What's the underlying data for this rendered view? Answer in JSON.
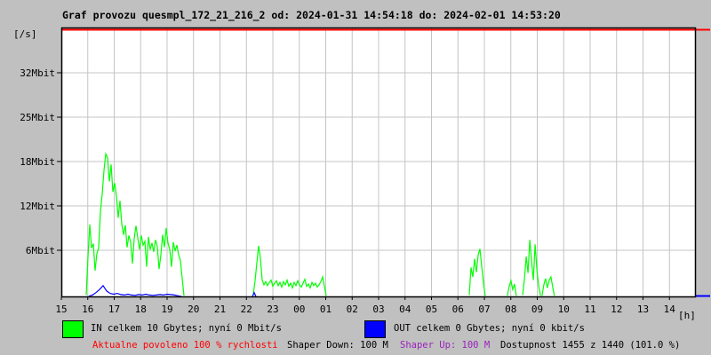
{
  "title": "Graf provozu quesmpl_172_21_216_2 od: 2024-01-31 14:54:18 do: 2024-02-01 14:53:20",
  "colors": {
    "background": "#c0c0c0",
    "plot_background": "#ffffff",
    "grid": "#c4c4c4",
    "border": "#000000",
    "in_series": "#00ff00",
    "out_series": "#0000ff",
    "down_limit_line": "#ff0000",
    "up_limit_line": "#0000ff",
    "allowed_text": "#ff0000",
    "shaper_up_text": "#9922bb"
  },
  "axis": {
    "y_unit": "[/s]",
    "x_unit": "[h]"
  },
  "legend": {
    "in": {
      "label": "IN celkem 10 Gbytes; nyní 0 Mbit/s"
    },
    "out": {
      "label": "OUT celkem 0 Gbytes; nyní 0 kbit/s"
    }
  },
  "footer": {
    "allowed": "Aktualne povoleno 100 % rychlosti",
    "shaper_down": "Shaper Down: 100 M",
    "shaper_up": "Shaper Up: 100 M",
    "availability": "Dostupnost 1455 z 1440 (101.0 %)"
  },
  "chart_data": {
    "type": "line",
    "title": "Graf provozu quesmpl_172_21_216_2 od: 2024-01-31 14:54:18 do: 2024-02-01 14:53:20",
    "xlabel": "[h]",
    "ylabel": "[/s]",
    "x_hour_labels": [
      "15",
      "16",
      "17",
      "18",
      "19",
      "20",
      "21",
      "22",
      "23",
      "00",
      "01",
      "02",
      "03",
      "04",
      "05",
      "06",
      "07",
      "08",
      "09",
      "10",
      "11",
      "12",
      "13",
      "14"
    ],
    "x_range_hours": [
      0,
      24
    ],
    "y_ticks": [
      {
        "label": "6Mbit",
        "value": 6
      },
      {
        "label": "12Mbit",
        "value": 12
      },
      {
        "label": "18Mbit",
        "value": 18
      },
      {
        "label": "25Mbit",
        "value": 25
      },
      {
        "label": "32Mbit",
        "value": 32
      }
    ],
    "ylim_top_mbit": 38.5,
    "grid": true,
    "legend_position": "bottom",
    "limit_lines": [
      {
        "name": "shaper-down-limit",
        "color": "#ff0000",
        "position": "top"
      },
      {
        "name": "shaper-up-limit",
        "color": "#0000ff",
        "position": "bottom-right"
      }
    ],
    "series": [
      {
        "name": "IN",
        "unit": "Mbit/s",
        "color": "#00ff00",
        "segments": [
          {
            "t_start_hours": 0.941,
            "t_step_hours": 0.0672,
            "values_mbit": [
              0.3,
              5.2,
              9.5,
              6.3,
              6.9,
              3.4,
              5.6,
              6.3,
              11.2,
              13.6,
              16.8,
              19.2,
              18.6,
              15.3,
              17.6,
              13.9,
              15.1,
              13.3,
              10.4,
              12.7,
              9.6,
              8.1,
              9.4,
              6.4,
              8.0,
              7.1,
              4.3,
              7.6,
              9.3,
              7.7,
              6.1,
              8.0,
              6.7,
              7.2,
              3.9,
              7.8,
              6.1,
              7.0,
              5.8,
              7.4,
              6.5,
              3.6,
              5.4,
              8.1,
              6.4,
              9.0,
              7.0,
              6.1,
              3.9,
              7.1,
              5.9,
              6.7,
              5.4,
              4.7,
              2.4,
              0.2
            ]
          },
          {
            "t_start_hours": 7.26,
            "t_step_hours": 0.0672,
            "values_mbit": [
              0.4,
              2.1,
              4.4,
              6.6,
              5.0,
              2.2,
              1.6,
              2.0,
              1.5,
              1.9,
              2.2,
              1.4,
              1.8,
              2.1,
              1.5,
              1.9,
              1.3,
              2.0,
              1.6,
              2.2,
              1.4,
              1.8,
              1.2,
              1.9,
              1.5,
              2.1,
              1.6,
              1.3,
              1.8,
              2.3,
              1.4,
              1.7,
              1.2,
              1.9,
              1.5,
              1.8,
              1.3,
              1.6,
              2.0,
              2.6,
              1.4,
              0.2
            ]
          },
          {
            "t_start_hours": 15.43,
            "t_step_hours": 0.0672,
            "values_mbit": [
              0.3,
              3.8,
              2.6,
              4.9,
              3.2,
              5.4,
              6.2,
              4.0,
              1.8,
              0.2
            ]
          },
          {
            "t_start_hours": 16.87,
            "t_step_hours": 0.0672,
            "values_mbit": [
              0.2,
              1.4,
              2.1,
              1.0,
              1.7,
              0.2
            ]
          },
          {
            "t_start_hours": 17.45,
            "t_step_hours": 0.0672,
            "values_mbit": [
              0.3,
              2.4,
              5.2,
              3.1,
              7.4,
              4.6,
              2.2,
              6.8,
              3.5,
              1.5,
              0.2
            ]
          },
          {
            "t_start_hours": 18.18,
            "t_step_hours": 0.0672,
            "values_mbit": [
              0.2,
              1.6,
              2.4,
              1.2,
              2.2,
              2.6,
              1.3,
              0.2
            ]
          }
        ]
      },
      {
        "name": "OUT",
        "unit": "Mbit/s",
        "color": "#0000ff",
        "segments": [
          {
            "t_start_hours": 1.042,
            "t_step_hours": 0.1345,
            "values_mbit": [
              0.15,
              0.3,
              0.6,
              1.0,
              1.5,
              0.8,
              0.5,
              0.4,
              0.5,
              0.35,
              0.3,
              0.4,
              0.3,
              0.25,
              0.35,
              0.3,
              0.4,
              0.3,
              0.25,
              0.3,
              0.35,
              0.3,
              0.4,
              0.35,
              0.3,
              0.2,
              0.1
            ]
          },
          {
            "t_start_hours": 7.227,
            "t_step_hours": 0.0672,
            "values_mbit": [
              0.1,
              0.6,
              0.1
            ]
          }
        ]
      }
    ]
  }
}
